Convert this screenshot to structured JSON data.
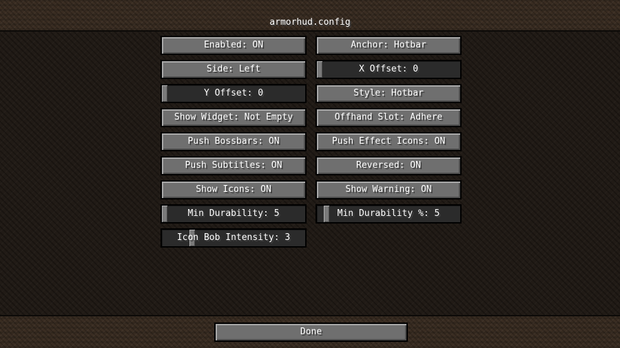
{
  "screen": {
    "title": "armorhud.config"
  },
  "options": {
    "enabled": "Enabled: ON",
    "anchor": "Anchor: Hotbar",
    "side": "Side: Left",
    "x_offset": {
      "label": "X Offset: 0",
      "value": 0
    },
    "y_offset": {
      "label": "Y Offset: 0",
      "value": 0
    },
    "style": "Style: Hotbar",
    "show_widget": "Show Widget: Not Empty",
    "offhand_slot": "Offhand Slot: Adhere",
    "push_bossbars": "Push Bossbars: ON",
    "push_effect_icons": "Push Effect Icons: ON",
    "push_subtitles": "Push Subtitles: ON",
    "reversed": "Reversed: ON",
    "show_icons": "Show Icons: ON",
    "show_warning": "Show Warning: ON",
    "min_durability": {
      "label": "Min Durability: 5",
      "value": 5
    },
    "min_durability_x": {
      "label": "Min Durability %: 5",
      "value": 5
    },
    "icon_bob_intensity": {
      "label": "Icon Bob Intensity: 3",
      "value": 3
    }
  },
  "footer": {
    "done_label": "Done"
  }
}
